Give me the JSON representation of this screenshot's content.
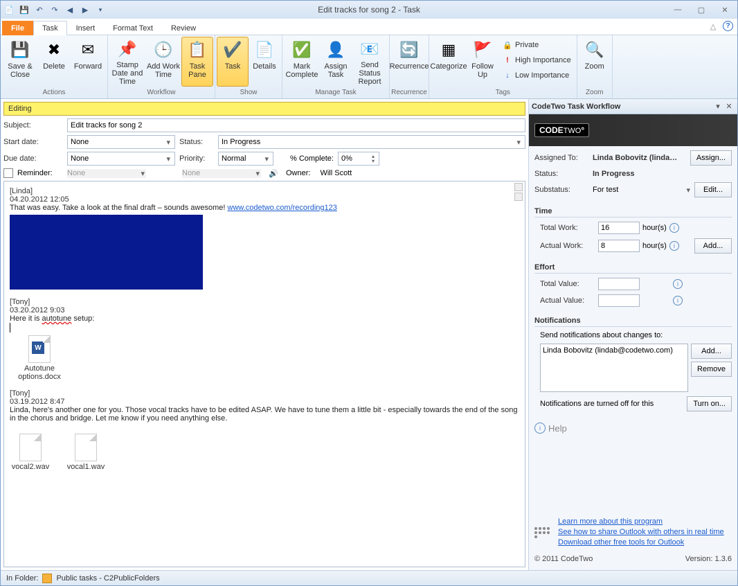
{
  "window": {
    "title": "Edit tracks for song 2  -  Task"
  },
  "tabs": {
    "file": "File",
    "task": "Task",
    "insert": "Insert",
    "format": "Format Text",
    "review": "Review"
  },
  "ribbon": {
    "actions": {
      "save": "Save & Close",
      "delete": "Delete",
      "forward": "Forward",
      "group": "Actions"
    },
    "workflow": {
      "stamp": "Stamp Date and Time",
      "addwork": "Add Work Time",
      "taskpane": "Task Pane",
      "group": "Workflow"
    },
    "show": {
      "task": "Task",
      "details": "Details",
      "group": "Show"
    },
    "manage": {
      "mark": "Mark Complete",
      "assign": "Assign Task",
      "status": "Send Status Report",
      "group": "Manage Task"
    },
    "recurrence": {
      "btn": "Recurrence",
      "group": "Recurrence"
    },
    "tags": {
      "categorize": "Categorize",
      "followup": "Follow Up",
      "private": "Private",
      "high": "High Importance",
      "low": "Low Importance",
      "group": "Tags"
    },
    "zoom": {
      "btn": "Zoom",
      "group": "Zoom"
    }
  },
  "editing": "Editing",
  "form": {
    "subject_label": "Subject:",
    "subject": "Edit tracks for song 2",
    "start_label": "Start date:",
    "start": "None",
    "due_label": "Due date:",
    "due": "None",
    "status_label": "Status:",
    "status": "In Progress",
    "priority_label": "Priority:",
    "priority": "Normal",
    "complete_label": "% Complete:",
    "complete": "0%",
    "reminder_label": "Reminder:",
    "reminder_date": "None",
    "reminder_time": "None",
    "owner_label": "Owner:",
    "owner": "Will Scott"
  },
  "body": {
    "e1": {
      "who": "[Linda]",
      "ts": "04.20.2012 12:05",
      "text": "That was easy. Take a look at the final draft – sounds awesome! ",
      "link": "www.codetwo.com/recording123"
    },
    "e2": {
      "who": "[Tony]",
      "ts": "03.20.2012 9:03",
      "text": "Here it is autotune setup:",
      "att": "Autotune options.docx"
    },
    "e3": {
      "who": "[Tony]",
      "ts": "03.19.2012 8:47",
      "text": "Linda, here's another one for you. Those vocal tracks have to be edited ASAP. We have to tune them a little bit - especially towards the end of the song in the chorus and bridge. Let me know if you need anything else.",
      "att1": "vocal2.wav",
      "att2": "vocal1.wav"
    }
  },
  "pane": {
    "title": "CodeTwo Task Workflow",
    "assigned_label": "Assigned To:",
    "assigned": "Linda Bobovitz (linda…",
    "assign_btn": "Assign...",
    "status_label": "Status:",
    "status": "In Progress",
    "substatus_label": "Substatus:",
    "substatus": "For test",
    "edit_btn": "Edit...",
    "time_head": "Time",
    "total_work_label": "Total Work:",
    "total_work": "16",
    "hours": "hour(s)",
    "actual_work_label": "Actual Work:",
    "actual_work": "8",
    "add_btn": "Add...",
    "effort_head": "Effort",
    "total_value_label": "Total Value:",
    "actual_value_label": "Actual Value:",
    "notif_head": "Notifications",
    "notif_text": "Send notifications about changes to:",
    "notif_entry": "Linda Bobovitz (lindab@codetwo.com)",
    "remove_btn": "Remove",
    "notif_off": "Notifications are turned off for this",
    "turnon_btn": "Turn on...",
    "help": "Help",
    "link1": "Learn more about this program",
    "link2": "See how to share Outlook with others in real time",
    "link3": "Download other free tools for Outlook",
    "copyright": "© 2011 CodeTwo",
    "version": "Version: 1.3.6"
  },
  "status": {
    "infolder": "In Folder:",
    "path": "Public tasks - C2PublicFolders"
  }
}
